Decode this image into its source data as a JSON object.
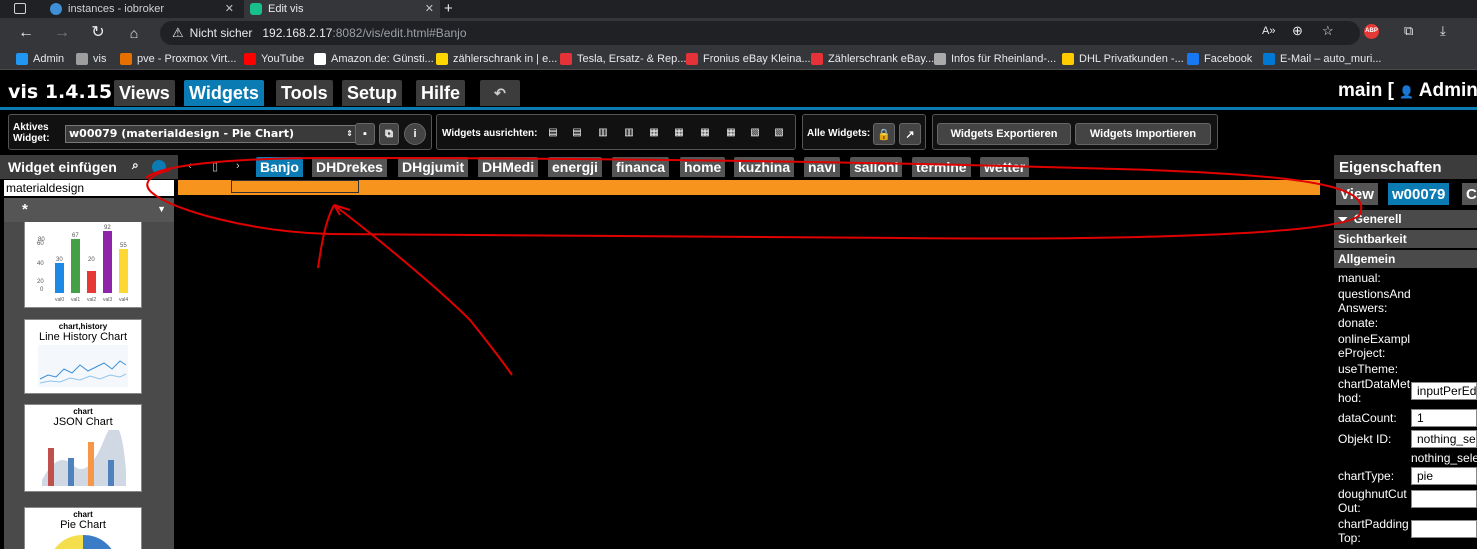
{
  "browser": {
    "tabs": [
      {
        "title": "instances - iobroker"
      },
      {
        "title": "Edit vis"
      }
    ],
    "nav": {
      "back_icon": "arrow-left-icon",
      "forward_icon": "arrow-right-icon",
      "reload_icon": "reload-icon",
      "home_icon": "home-icon"
    },
    "address": {
      "security_label": "Nicht sicher",
      "host": "192.168.2.17",
      "path": ":8082/vis/edit.html#Banjo"
    },
    "bookmarks": [
      {
        "label": "Admin",
        "color": "#2196f3"
      },
      {
        "label": "vis",
        "color": "#9e9e9e"
      },
      {
        "label": "pve - Proxmox Virt...",
        "color": "#e57000"
      },
      {
        "label": "YouTube",
        "color": "#ff0000"
      },
      {
        "label": "Amazon.de: Günsti...",
        "color": "#ffffff"
      },
      {
        "label": "zählerschrank in | e...",
        "color": "#ffd700"
      },
      {
        "label": "Tesla, Ersatz- & Rep...",
        "color": "#e53238"
      },
      {
        "label": "Fronius eBay Kleina...",
        "color": "#e53238"
      },
      {
        "label": "Zählerschrank eBay...",
        "color": "#e53238"
      },
      {
        "label": "Infos für Rheinland-...",
        "color": "#aaaaaa"
      },
      {
        "label": "DHL Privatkunden -...",
        "color": "#ffcc00"
      },
      {
        "label": "Facebook",
        "color": "#1877f2"
      },
      {
        "label": "E-Mail – auto_muri...",
        "color": "#0078d4"
      }
    ]
  },
  "app": {
    "name": "vis 1.4.15",
    "menu": [
      "Views",
      "Widgets",
      "Tools",
      "Setup",
      "Hilfe"
    ],
    "active_menu": "Widgets",
    "undo_icon": "undo-icon",
    "right_title": "main [",
    "user_label": "Admin"
  },
  "toolbar": {
    "active_widget_label_1": "Aktives",
    "active_widget_label_2": "Widget:",
    "active_widget_value": "w00079 (materialdesign - Pie Chart)",
    "align_label": "Widgets ausrichten:",
    "all_widgets_label": "Alle Widgets:",
    "export_label": "Widgets Exportieren",
    "import_label": "Widgets Importieren"
  },
  "left_panel": {
    "title": "Widget einfügen",
    "filter_value": "materialdesign",
    "category_value": "*",
    "widgets": [
      {
        "set": "",
        "name": "",
        "bar_values": [
          "80",
          "30",
          "67",
          "20",
          "92",
          "55"
        ]
      },
      {
        "set": "chart,history",
        "name": "Line History Chart"
      },
      {
        "set": "chart",
        "name": "JSON Chart"
      },
      {
        "set": "chart",
        "name": "Pie Chart"
      }
    ],
    "chart_axis_labels": [
      "60",
      "40",
      "20",
      "0"
    ],
    "chart_x_labels": [
      "val0",
      "val1",
      "val2",
      "val3",
      "val4"
    ]
  },
  "views": {
    "tabs": [
      "Banjo",
      "DHDrekes",
      "DHgjumit",
      "DHMedi",
      "energji",
      "financa",
      "home",
      "kuzhina",
      "navi",
      "salloni",
      "termine",
      "wetter"
    ],
    "active": "Banjo"
  },
  "right_panel": {
    "title": "Eigenschaften",
    "tabs": [
      "View",
      "w00079",
      "C"
    ],
    "active_tab": "w00079",
    "sections": [
      "Generell",
      "Sichtbarkeit",
      "Allgemein"
    ],
    "props": [
      {
        "label": "manual:",
        "value": ""
      },
      {
        "label": "questionsAndAnswers:",
        "value": ""
      },
      {
        "label": "donate:",
        "value": ""
      },
      {
        "label": "onlineExampleProject:",
        "value": ""
      },
      {
        "label": "useTheme:",
        "value": ""
      },
      {
        "label": "chartDataMethod:",
        "value": "inputPerEditor"
      },
      {
        "label": "dataCount:",
        "value": "1"
      },
      {
        "label": "Objekt ID:",
        "value": "nothing_selected"
      },
      {
        "label": "",
        "value": "nothing_selected"
      },
      {
        "label": "chartType:",
        "value": "pie"
      },
      {
        "label": "doughnutCutOut:",
        "value": ""
      },
      {
        "label": "chartPaddingTop:",
        "value": ""
      }
    ]
  }
}
